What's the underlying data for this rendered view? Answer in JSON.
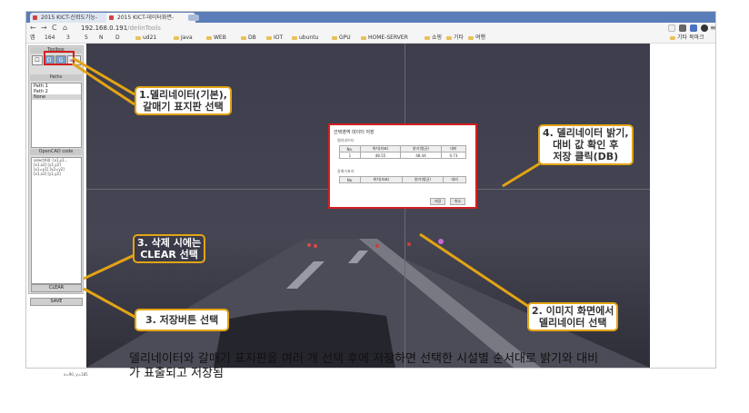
{
  "tabs": [
    {
      "label": "2015 KICT-신뢰도기능-",
      "active": false
    },
    {
      "label": "2015 KICT-데이터화면-",
      "active": true
    }
  ],
  "address": {
    "host": "192.168.0.191",
    "path": "/delinTools"
  },
  "bookmarks": [
    "앱",
    "164",
    "3",
    "5",
    "N",
    "D",
    "ud21",
    "Java",
    "WEB",
    "DB",
    "IOT",
    "ubuntu",
    "GPU",
    "HOME-SERVER",
    "쇼핑",
    "기타",
    "여행"
  ],
  "bookmarks_right": "기타 북마크",
  "panel": {
    "toolbox_title": "Toolbox",
    "tool_buttons": [
      "☐",
      "D",
      "G",
      "none"
    ],
    "paths_title": "Paths",
    "paths": [
      "Path 1",
      "Path 2",
      "None"
    ],
    "code_title": "OpenCAD code",
    "code_lines": [
      "selectAll(: [x1,y1...",
      "[x1,x2] [y1,y2]",
      "[x1=y1] [x2=y2]",
      "[x1,x2] [y1,y2]"
    ],
    "clear_label": "CLEAR",
    "save_label": "SAVE"
  },
  "dialog": {
    "title": "선택영역 데이터 저장",
    "section1": "델리네이터",
    "table1_header": [
      "No.",
      "위치(좌표)",
      "밝기(평균)",
      "대비"
    ],
    "table1_row": [
      "1",
      "48.55",
      "48.44",
      "0.73"
    ],
    "section2": "갈매기표지",
    "table2_header": [
      "No.",
      "위치(좌표)",
      "밝기(평균)",
      "대비"
    ],
    "save_button": "저장",
    "close_button": "취소"
  },
  "status": "x=90, y=185",
  "callouts": {
    "c1": "1.델리네이터(기본),\n갈매기 표지판 선택",
    "c2": "2. 이미지 화면에서\n델리네이터 선택",
    "c3a": "3. 삭제 시에는\nCLEAR 선택",
    "c3b": "3. 저장버튼 선택",
    "c4": "4. 델리네이터 밝기,\n대비 값 확인 후\n저장 클릭(DB)"
  },
  "caption": "델리네이터와 갈매기 표지판을 여러 개 선택 후에 저장하면 선택한 시설별 순서대로 밝기와 대비\n가 표출되고 저장됨",
  "colors": {
    "highlight": "#d31f1f",
    "callout_border": "#e3a414",
    "tabbar": "#5a7db8"
  }
}
